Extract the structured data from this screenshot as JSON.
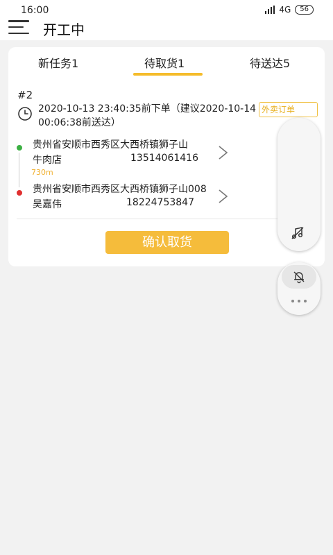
{
  "status_bar": {
    "time": "16:00",
    "network": "4G",
    "battery": "56"
  },
  "header": {
    "title": "开工中"
  },
  "tabs": [
    {
      "label": "新任务1",
      "active": false
    },
    {
      "label": "待取货1",
      "active": true
    },
    {
      "label": "待送达5",
      "active": false
    }
  ],
  "order": {
    "number": "#2",
    "time_text": "2020-10-13 23:40:35前下单（建议2020-10-14 00:06:38前送达）",
    "type_badge": "外卖订单",
    "pickup": {
      "address": "贵州省安顺市西秀区大西桥镇狮子山",
      "name": "牛肉店",
      "phone": "13514061416"
    },
    "distance": "730m",
    "dropoff": {
      "address": "贵州省安顺市西秀区大西桥镇狮子山008",
      "name": "吴嘉伟",
      "phone": "18224753847"
    },
    "confirm_label": "确认取货"
  },
  "colors": {
    "accent": "#f5bc3b",
    "pickup_dot": "#3cb043",
    "dropoff_dot": "#e03030",
    "distance_text": "#f0b030"
  },
  "icons": {
    "menu": "hamburger-icon",
    "clock": "clock-icon",
    "chevron": "chevron-right-icon",
    "music_off": "music-off-icon",
    "bell_off": "bell-off-icon",
    "more": "more-dots-icon"
  }
}
